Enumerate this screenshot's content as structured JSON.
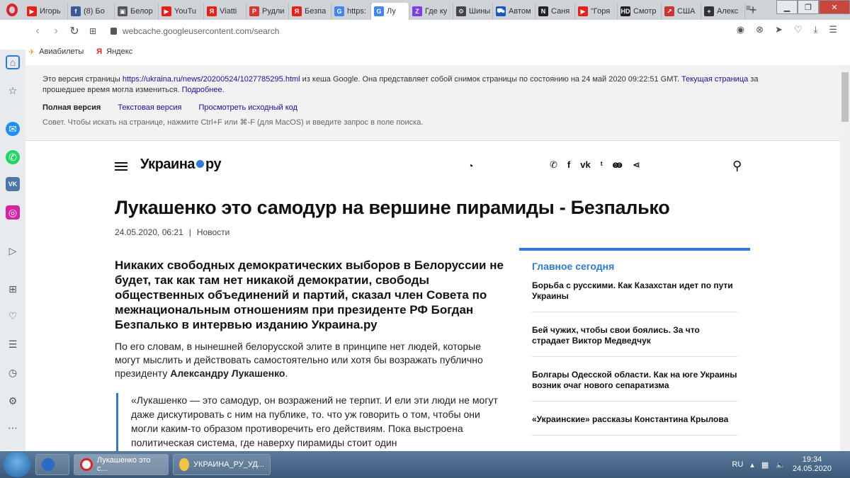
{
  "tabs": [
    {
      "label": "Игорь",
      "color": "#e62117",
      "glyph": "▶"
    },
    {
      "label": "(8) Бо",
      "color": "#3b5998",
      "glyph": "f"
    },
    {
      "label": "Белор",
      "color": "#555",
      "glyph": "▣"
    },
    {
      "label": "YouTu",
      "color": "#e62117",
      "glyph": "▶"
    },
    {
      "label": "Viatti",
      "color": "#e62117",
      "glyph": "Я"
    },
    {
      "label": "Рудли",
      "color": "#d33",
      "glyph": "P"
    },
    {
      "label": "Безпа",
      "color": "#e62117",
      "glyph": "Я"
    },
    {
      "label": "https:",
      "color": "#4285f4",
      "glyph": "G"
    },
    {
      "label": "Лу",
      "color": "#4285f4",
      "glyph": "G",
      "active": true
    },
    {
      "label": "Где ку",
      "color": "#7b3fe4",
      "glyph": "Z"
    },
    {
      "label": "Шины",
      "color": "#444",
      "glyph": "⚙"
    },
    {
      "label": "Автом",
      "color": "#1a56c4",
      "glyph": "⛟"
    },
    {
      "label": "Саня",
      "color": "#222",
      "glyph": "N"
    },
    {
      "label": "\"Горя",
      "color": "#e62117",
      "glyph": "▶"
    },
    {
      "label": "Смотр",
      "color": "#222",
      "glyph": "HD"
    },
    {
      "label": "США",
      "color": "#c33",
      "glyph": "↗"
    },
    {
      "label": "Алекс",
      "color": "#333",
      "glyph": "+"
    }
  ],
  "newtab": "+",
  "address": {
    "url": "webcache.googleusercontent.com/search"
  },
  "bookmarks": [
    {
      "label": "Авиабилеты",
      "icon": "plane-icon"
    },
    {
      "label": "Яндекс",
      "icon": "yandex-icon"
    }
  ],
  "cache": {
    "line1_pre": "Это версия страницы ",
    "line1_link": "https://ukraina.ru/news/20200524/1027785295.html",
    "line1_mid": " из кеша Google. Она представляет собой снимок страницы по состоянию на 24 май 2020 09:22:51 GMT. ",
    "line1_link2": "Текущая страница",
    "line1_post": " за",
    "line2_pre": "прошедшее время могла измениться. ",
    "line2_link": "Подробнее.",
    "version_full": "Полная версия",
    "version_text": "Текстовая версия",
    "version_source": "Просмотреть исходный код",
    "tip": "Совет. Чтобы искать на странице, нажмите Ctrl+F или ⌘-F (для MacOS) и введите запрос в поле поиска."
  },
  "site": {
    "logo_left": "Украина",
    "logo_right": "ру"
  },
  "article": {
    "headline": "Лукашенко это самодур на вершине пирамиды - Безпалько",
    "date": "24.05.2020, 06:21",
    "separator": "|",
    "section": "Новости",
    "lead": "Никаких свободных демократических выборов в Белоруссии не будет, так как там нет никакой демократии, свободы общественных объединений и партий, сказал член Совета по межнациональным отношениям при президенте РФ Богдан Безпалько в интервью изданию Украина.ру",
    "para_pre": "По его словам, в нынешней белорусской элите в принципе нет людей, которые могут мыслить и действовать самостоятельно или хотя бы возражать публично президенту ",
    "para_bold": "Александру Лукашенко",
    "para_post": ".",
    "quote": "«Лукашенко — это самодур, он возражений не терпит. И ели эти люди не могут даже дискутировать с ним на публике, то. что уж говорить о том, чтобы они могли каким-то образом противоречить его действиям. Пока выстроена политическая система, где наверху пирамиды стоит один"
  },
  "topnews": {
    "title": "Главное сегодня",
    "items": [
      "Борьба с русскими. Как Казахстан идет по пути Украины",
      "Бей чужих, чтобы свои боялись. За что страдает Виктор Медведчук",
      "Болгары Одесской области. Как на юге Украины возник очаг нового сепаратизма",
      "«Украинские» рассказы Константина Крылова"
    ]
  },
  "taskbar": {
    "btn1": "Лукашенко это с...",
    "btn2": "УКРАИНА_РУ_УД...",
    "lang": "RU",
    "time": "19:34",
    "date": "24.05.2020"
  },
  "colors": {
    "accent": "#2f7ad4",
    "opera_red": "#e0202a"
  }
}
